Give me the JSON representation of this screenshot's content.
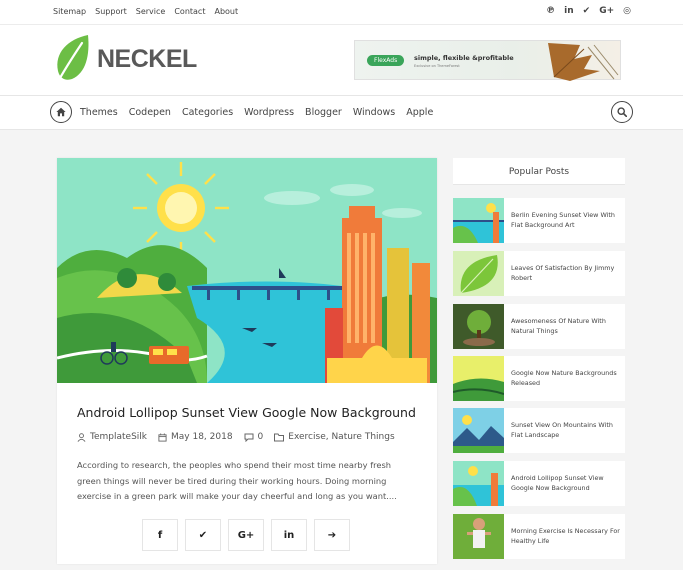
{
  "topbar": {
    "links": [
      "Sitemap",
      "Support",
      "Service",
      "Contact",
      "About"
    ],
    "social": [
      {
        "icon": "pinterest-icon",
        "glyph": "℗"
      },
      {
        "icon": "linkedin-icon",
        "glyph": "in"
      },
      {
        "icon": "twitter-icon",
        "glyph": "✔"
      },
      {
        "icon": "google-plus-icon",
        "glyph": "G+"
      },
      {
        "icon": "instagram-icon",
        "glyph": "◎"
      }
    ]
  },
  "header": {
    "logo_text": "NECKEL",
    "ad": {
      "badge": "FlexAds",
      "headline": "simple, flexible &profitable",
      "sub": "Exclusive on ThemeForest"
    }
  },
  "nav": {
    "items": [
      "Themes",
      "Codepen",
      "Categories",
      "Wordpress",
      "Blogger",
      "Windows",
      "Apple"
    ]
  },
  "post": {
    "title": "Android Lollipop Sunset View Google Now Background",
    "author": "TemplateSilk",
    "date": "May 18, 2018",
    "comments": "0",
    "categories": "Exercise, Nature Things",
    "excerpt": "According to research, the peoples who spend their most time nearby fresh green things will never be tired during their working hours. Doing morning exercise in a green park will make your day cheerful and long as you want....",
    "share": [
      {
        "icon": "facebook-icon",
        "glyph": "f"
      },
      {
        "icon": "twitter-icon",
        "glyph": "✔"
      },
      {
        "icon": "google-plus-icon",
        "glyph": "G+"
      },
      {
        "icon": "linkedin-icon",
        "glyph": "in"
      },
      {
        "icon": "arrow-right-icon",
        "glyph": "➔"
      }
    ]
  },
  "sidebar": {
    "title": "Popular Posts",
    "posts": [
      {
        "title": "Berlin Evening Sunset View With Flat Background Art"
      },
      {
        "title": "Leaves Of Satisfaction By Jimmy Robert"
      },
      {
        "title": "Awesomeness Of Nature With Natural Things"
      },
      {
        "title": "Google Now Nature Backgrounds Released"
      },
      {
        "title": "Sunset View On Mountains With Flat Landscape"
      },
      {
        "title": "Android Lollipop Sunset View Google Now Background"
      },
      {
        "title": "Morning Exercise Is Necessary For Healthy Life"
      }
    ]
  },
  "colors": {
    "brand_green": "#6cbe45",
    "accent_teal": "#3ec7c8"
  }
}
